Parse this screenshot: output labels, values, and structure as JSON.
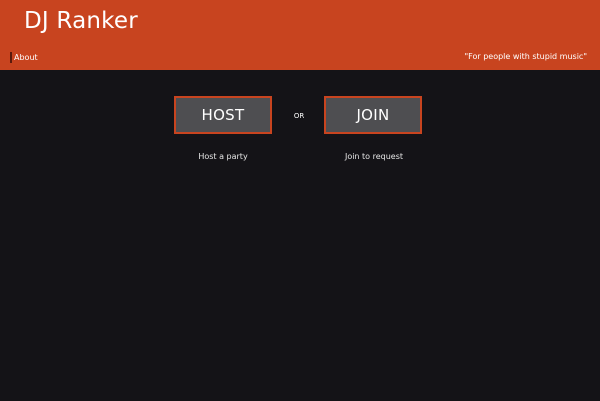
{
  "header": {
    "title": "DJ Ranker",
    "about_label": "About",
    "tagline": "\"For people with stupid music\""
  },
  "main": {
    "host_label": "HOST",
    "join_label": "JOIN",
    "or_label": "OR",
    "host_caption": "Host a party",
    "join_caption": "Join to request"
  },
  "colors": {
    "accent": "#c8441f",
    "background": "#141317",
    "button_fill": "#4e4e51"
  }
}
